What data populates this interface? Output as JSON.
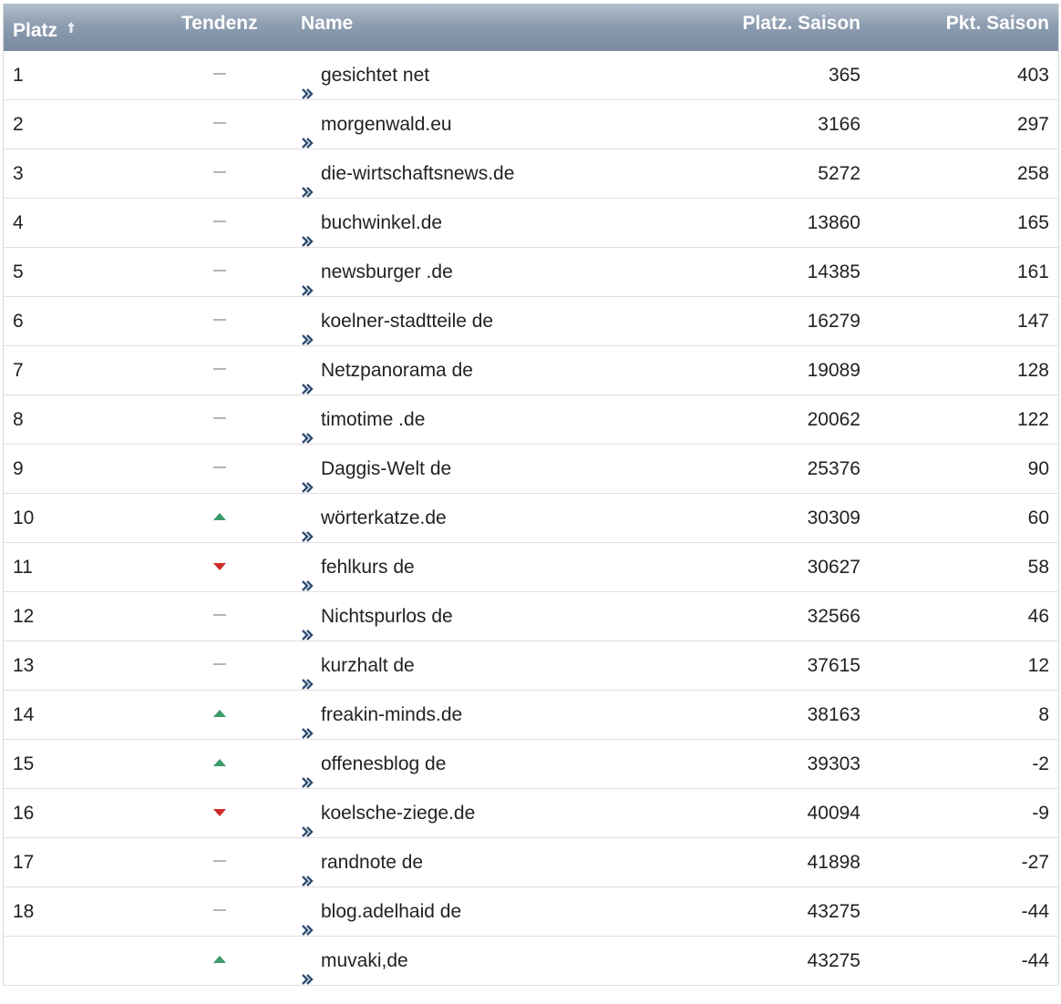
{
  "header": {
    "platz": "Platz",
    "tendenz": "Tendenz",
    "name": "Name",
    "platz_saison": "Platz. Saison",
    "pkt_saison": "Pkt. Saison"
  },
  "colors": {
    "header_gradient_top": "#b3bfcd",
    "header_gradient_bottom": "#7a8a9f",
    "trend_up": "#3f9a6b",
    "trend_down": "#d12b2b",
    "trend_neutral": "#b5b5b5",
    "chevron": "#2f4e72"
  },
  "rows": [
    {
      "rank": "1",
      "trend": "neutral",
      "name": "gesichtet net",
      "platz_saison": "365",
      "pkt_saison": "403"
    },
    {
      "rank": "2",
      "trend": "neutral",
      "name": "morgenwald.eu",
      "platz_saison": "3166",
      "pkt_saison": "297"
    },
    {
      "rank": "3",
      "trend": "neutral",
      "name": "die-wirtschaftsnews.de",
      "platz_saison": "5272",
      "pkt_saison": "258"
    },
    {
      "rank": "4",
      "trend": "neutral",
      "name": "buchwinkel.de",
      "platz_saison": "13860",
      "pkt_saison": "165"
    },
    {
      "rank": "5",
      "trend": "neutral",
      "name": "newsburger .de",
      "platz_saison": "14385",
      "pkt_saison": "161"
    },
    {
      "rank": "6",
      "trend": "neutral",
      "name": "koelner-stadtteile de",
      "platz_saison": "16279",
      "pkt_saison": "147"
    },
    {
      "rank": "7",
      "trend": "neutral",
      "name": "Netzpanorama de",
      "platz_saison": "19089",
      "pkt_saison": "128"
    },
    {
      "rank": "8",
      "trend": "neutral",
      "name": "timotime .de",
      "platz_saison": "20062",
      "pkt_saison": "122"
    },
    {
      "rank": "9",
      "trend": "neutral",
      "name": "Daggis-Welt de",
      "platz_saison": "25376",
      "pkt_saison": "90"
    },
    {
      "rank": "10",
      "trend": "up",
      "name": "wörterkatze.de",
      "platz_saison": "30309",
      "pkt_saison": "60"
    },
    {
      "rank": "11",
      "trend": "down",
      "name": "fehlkurs de",
      "platz_saison": "30627",
      "pkt_saison": "58"
    },
    {
      "rank": "12",
      "trend": "neutral",
      "name": "Nichtspurlos de",
      "platz_saison": "32566",
      "pkt_saison": "46"
    },
    {
      "rank": "13",
      "trend": "neutral",
      "name": "kurzhalt de",
      "platz_saison": "37615",
      "pkt_saison": "12"
    },
    {
      "rank": "14",
      "trend": "up",
      "name": "freakin-minds.de",
      "platz_saison": "38163",
      "pkt_saison": "8"
    },
    {
      "rank": "15",
      "trend": "up",
      "name": "offenesblog de",
      "platz_saison": "39303",
      "pkt_saison": "-2"
    },
    {
      "rank": "16",
      "trend": "down",
      "name": "koelsche-ziege.de",
      "platz_saison": "40094",
      "pkt_saison": "-9"
    },
    {
      "rank": "17",
      "trend": "neutral",
      "name": "randnote de",
      "platz_saison": "41898",
      "pkt_saison": "-27"
    },
    {
      "rank": "18",
      "trend": "neutral",
      "name": "blog.adelhaid de",
      "platz_saison": "43275",
      "pkt_saison": "-44"
    },
    {
      "rank": "",
      "trend": "up",
      "name": "muvaki,de",
      "platz_saison": "43275",
      "pkt_saison": "-44"
    }
  ]
}
